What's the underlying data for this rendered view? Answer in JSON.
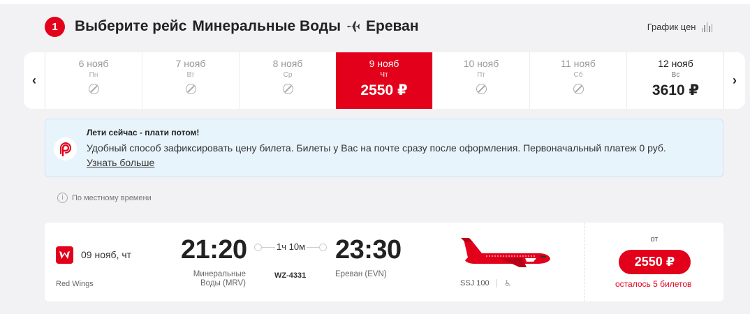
{
  "header": {
    "step": "1",
    "title_prefix": "Выберите рейс",
    "origin": "Минеральные Воды",
    "destination": "Ереван",
    "price_chart_label": "График цен"
  },
  "dates": [
    {
      "date": "6 нояб",
      "weekday": "Пн",
      "price": null
    },
    {
      "date": "7 нояб",
      "weekday": "Вт",
      "price": null
    },
    {
      "date": "8 нояб",
      "weekday": "Ср",
      "price": null
    },
    {
      "date": "9 нояб",
      "weekday": "Чт",
      "price": "2550 ₽",
      "selected": true
    },
    {
      "date": "10 нояб",
      "weekday": "Пт",
      "price": null
    },
    {
      "date": "11 нояб",
      "weekday": "Сб",
      "price": null
    },
    {
      "date": "12 нояб",
      "weekday": "Вс",
      "price": "3610 ₽"
    }
  ],
  "promo": {
    "title": "Лети сейчас - плати потом!",
    "text": "Удобный способ зафиксировать цену билета. Билеты у Вас на почте сразу после оформления. Первоначальный платеж 0 руб.",
    "link": "Узнать больше"
  },
  "local_time_note": "По местному времени",
  "flight": {
    "date": "09 нояб, чт",
    "airline": "Red Wings",
    "departure_time": "21:20",
    "departure_city": "Минеральные Воды (MRV)",
    "duration": "1ч 10м",
    "flight_number": "WZ-4331",
    "arrival_time": "23:30",
    "arrival_city": "Ереван (EVN)",
    "aircraft": "SSJ 100",
    "price_from": "от",
    "price": "2550 ₽",
    "seats_left": "осталось 5 билетов"
  },
  "colors": {
    "accent": "#e3001b",
    "promo_bg": "#e8f4fb"
  }
}
